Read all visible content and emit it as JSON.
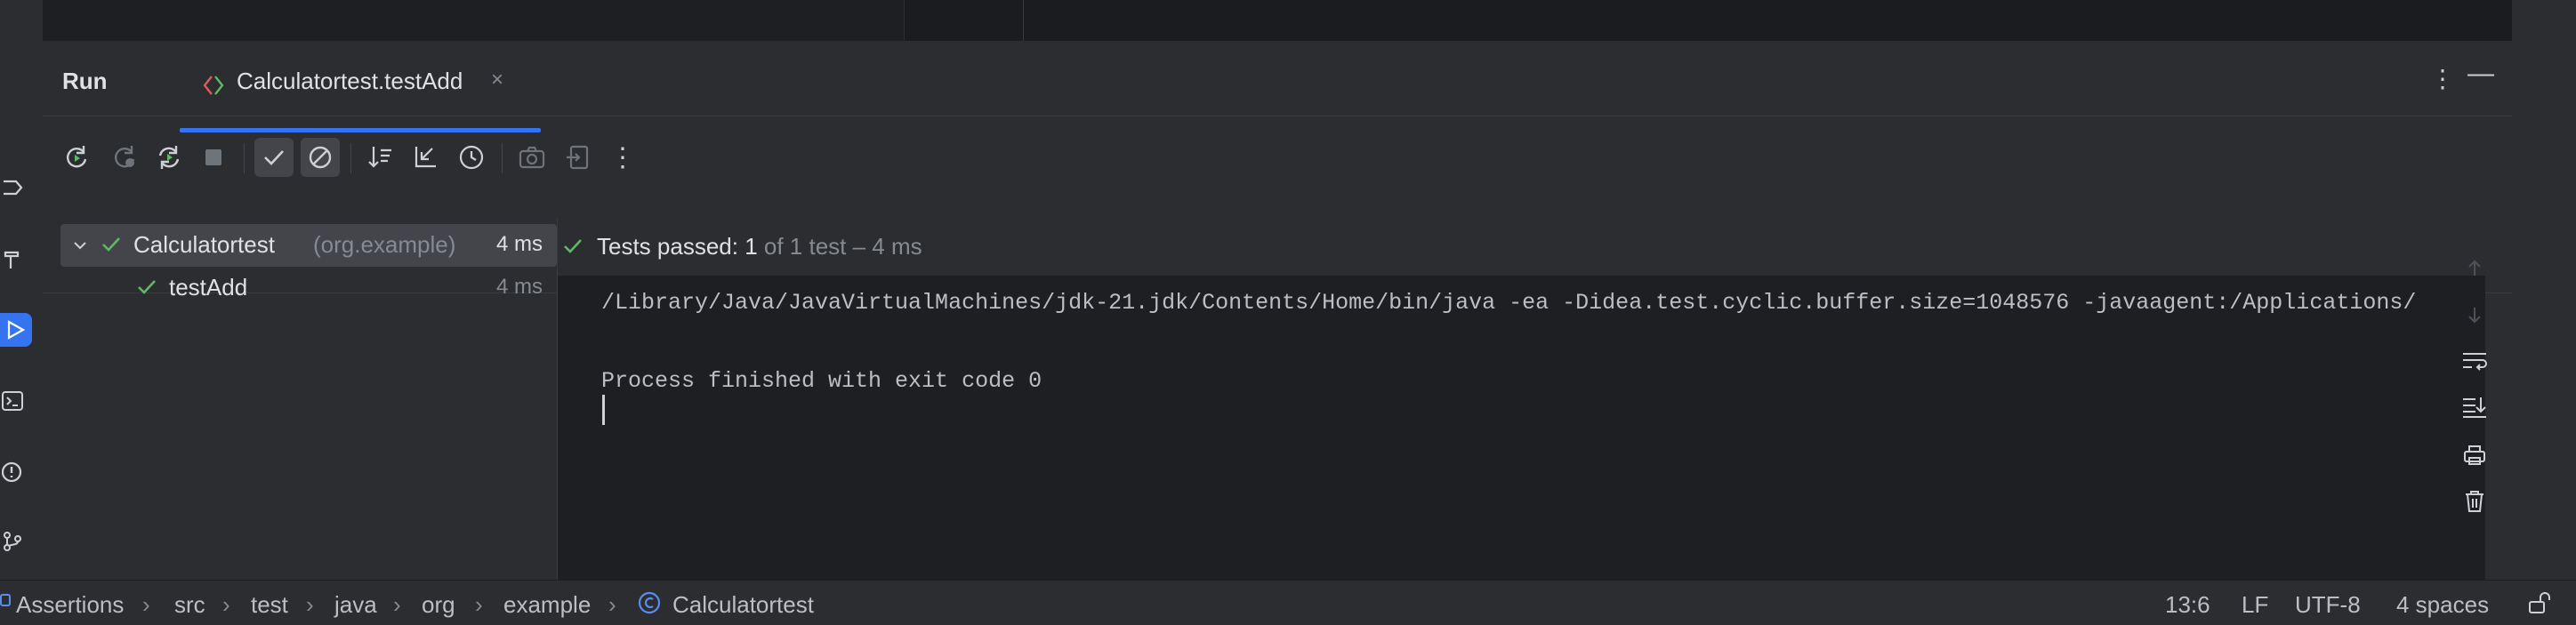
{
  "run_panel": {
    "title": "Run",
    "tab": {
      "label": "Calculatortest.testAdd",
      "close": "×"
    },
    "more_icon": "⋮",
    "minimize_icon": "—"
  },
  "toolbar": {
    "buttons": [
      "rerun-icon",
      "rerun-failed-icon",
      "toggle-auto-rerun-icon",
      "stop-icon",
      "show-passed-icon",
      "show-ignored-icon",
      "sort-icon",
      "collapse-icon",
      "history-icon",
      "screenshot-icon",
      "export-icon",
      "more-icon"
    ],
    "more": "⋮"
  },
  "tree": {
    "root": {
      "name": "Calculatortest",
      "package": "(org.example)",
      "time": "4 ms"
    },
    "child": {
      "name": "testAdd",
      "time": "4 ms"
    }
  },
  "console": {
    "status_passed": "Tests passed: 1",
    "status_rest": "of 1 test – 4 ms",
    "command": "/Library/Java/JavaVirtualMachines/jdk-21.jdk/Contents/Home/bin/java -ea -Didea.test.cyclic.buffer.size=1048576 -javaagent:/Applications/",
    "exit_line": "Process finished with exit code 0"
  },
  "status_bar": {
    "breadcrumbs": [
      "Assertions",
      "src",
      "test",
      "java",
      "org",
      "example",
      "Calculatortest"
    ],
    "separator": "›",
    "position": "13:6",
    "line_ending": "LF",
    "encoding": "UTF-8",
    "indent": "4 spaces"
  },
  "colors": {
    "accent": "#3574f0",
    "pass_green": "#5fb865",
    "panel_bg": "#2b2d30",
    "editor_bg": "#1e1f22"
  }
}
